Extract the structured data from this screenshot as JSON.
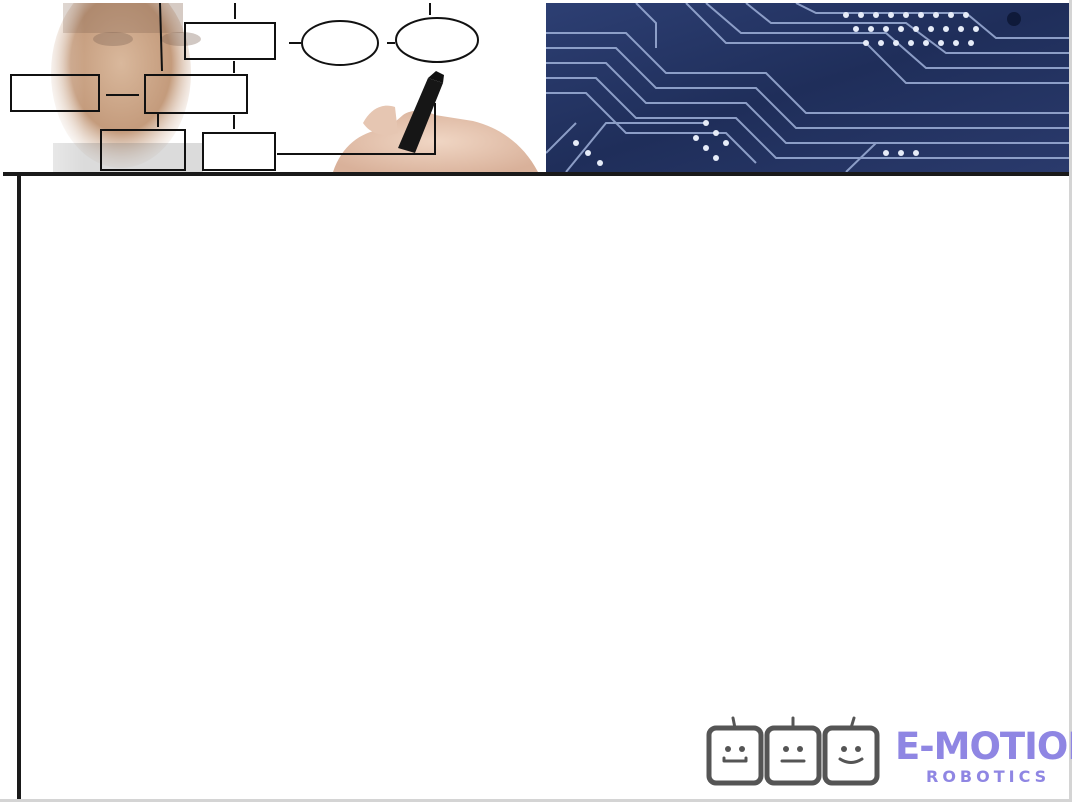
{
  "logo": {
    "title": "E-MOTION",
    "subtitle": "ROBOTICS",
    "color": "#8f86e3",
    "robot_outline_color": "#555555"
  },
  "banner": {
    "left_image": "person-drawing-flowchart",
    "right_image": "circuit-board",
    "circuit_color": "#21305c"
  },
  "frame_color": "#1a1a1a"
}
